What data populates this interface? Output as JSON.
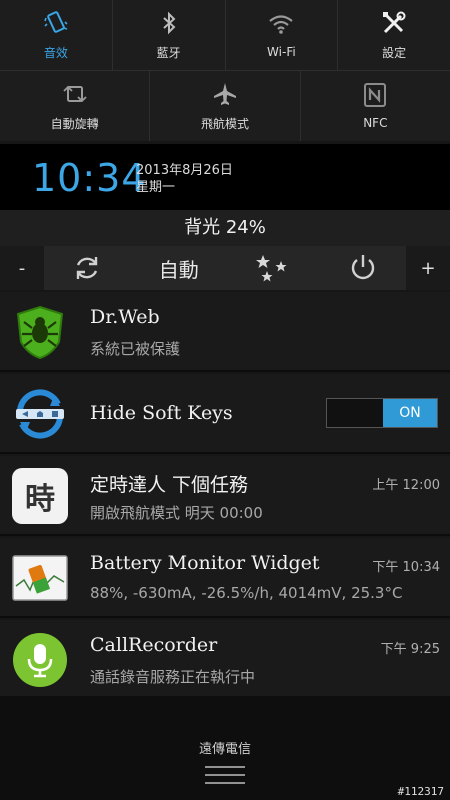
{
  "quick_settings": {
    "top": [
      {
        "label": "音效",
        "icon": "vibrate-icon",
        "active": true
      },
      {
        "label": "藍牙",
        "icon": "bluetooth-icon",
        "active": false
      },
      {
        "label": "Wi-Fi",
        "icon": "wifi-icon",
        "active": false
      },
      {
        "label": "設定",
        "icon": "settings-tools-icon",
        "active": false
      }
    ],
    "bottom": [
      {
        "label": "自動旋轉",
        "icon": "rotate-icon"
      },
      {
        "label": "飛航模式",
        "icon": "airplane-icon"
      },
      {
        "label": "NFC",
        "icon": "nfc-icon"
      }
    ]
  },
  "status": {
    "time": "10:34",
    "date": "2013年8月26日",
    "weekday": "星期一"
  },
  "brightness": {
    "label": "背光 24%",
    "decrease": "-",
    "increase": "+",
    "auto": "自動",
    "level": 0.24
  },
  "notifications": [
    {
      "title": "Dr.Web",
      "subtitle": "系統已被保護",
      "time": "",
      "icon": "drweb-spider-icon"
    },
    {
      "title": "Hide Soft Keys",
      "subtitle": "",
      "toggle_label": "ON",
      "icon": "hide-soft-keys-icon"
    },
    {
      "title": "定時達人 下個任務",
      "subtitle": "開啟飛航模式 明天 00:00",
      "time": "上午 12:00",
      "icon_text": "時",
      "icon": "timer-app-icon"
    },
    {
      "title": "Battery Monitor Widget",
      "subtitle": "88%, -630mA, -26.5%/h, 4014mV, 25.3°C",
      "time": "下午 10:34",
      "icon": "battery-monitor-icon"
    },
    {
      "title": "CallRecorder",
      "subtitle": "通話錄音服務正在執行中",
      "time": "下午 9:25",
      "icon": "microphone-icon"
    }
  ],
  "carrier": "遠傳電信",
  "watermark": "#112317",
  "colors": {
    "accent": "#3da6e6",
    "toggle_on": "#2f9ad6"
  }
}
